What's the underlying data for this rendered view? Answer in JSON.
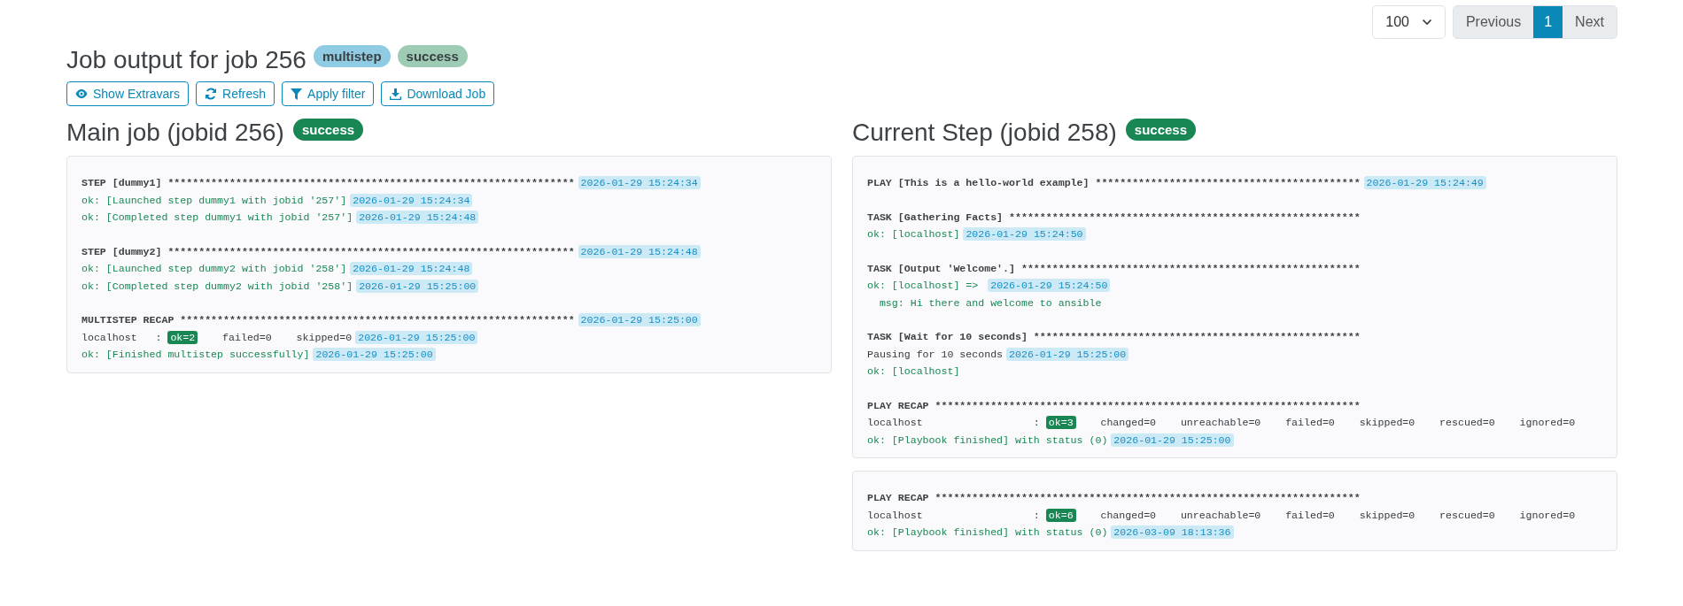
{
  "pagination": {
    "page_size": "100",
    "previous": "Previous",
    "pages": [
      {
        "label": "1",
        "selected": true
      }
    ],
    "next": "Next"
  },
  "header": {
    "title": "Job output for job 256",
    "badges": [
      {
        "label": "multistep",
        "kind": "type"
      },
      {
        "label": "success",
        "kind": "status"
      }
    ]
  },
  "toolbar": [
    {
      "label": "Show Extravars",
      "kind": "eye"
    },
    {
      "label": "Refresh",
      "kind": "refresh"
    },
    {
      "label": "Apply filter",
      "kind": "filter"
    },
    {
      "label": "Download Job",
      "kind": "download"
    }
  ],
  "panels": [
    {
      "title": "Main job (jobid 256)",
      "status": "success",
      "cards": [
        {
          "blocks": [
            [
              [
                {
                  "kind": "head",
                  "text": "STEP [dummy1] ******************************************************************"
                },
                {
                  "kind": "time",
                  "text": "2026-01-29 15:24:34"
                }
              ],
              [
                {
                  "kind": "ok",
                  "text": "ok: [Launched step dummy1 with jobid '257']"
                },
                {
                  "kind": "time",
                  "text": "2026-01-29 15:24:34"
                }
              ],
              [
                {
                  "kind": "ok",
                  "text": "ok: [Completed step dummy1 with jobid '257']"
                },
                {
                  "kind": "time",
                  "text": "2026-01-29 15:24:48"
                }
              ]
            ],
            [
              [
                {
                  "kind": "head",
                  "text": "STEP [dummy2] ******************************************************************"
                },
                {
                  "kind": "time",
                  "text": "2026-01-29 15:24:48"
                }
              ],
              [
                {
                  "kind": "ok",
                  "text": "ok: [Launched step dummy2 with jobid '258']"
                },
                {
                  "kind": "time",
                  "text": "2026-01-29 15:24:48"
                }
              ],
              [
                {
                  "kind": "ok",
                  "text": "ok: [Completed step dummy2 with jobid '258']"
                },
                {
                  "kind": "time",
                  "text": "2026-01-29 15:25:00"
                }
              ]
            ],
            [
              [
                {
                  "kind": "head",
                  "text": "MULTISTEP RECAP ****************************************************************"
                },
                {
                  "kind": "time",
                  "text": "2026-01-29 15:25:00"
                }
              ],
              [
                {
                  "kind": "plain",
                  "text": "localhost   : "
                },
                {
                  "kind": "count",
                  "text": "ok=2"
                },
                {
                  "kind": "plain",
                  "text": "    failed=0    skipped=0"
                },
                {
                  "kind": "time",
                  "text": "2026-01-29 15:25:00"
                }
              ],
              [
                {
                  "kind": "ok",
                  "text": "ok: [Finished multistep successfully]"
                },
                {
                  "kind": "time",
                  "text": "2026-01-29 15:25:00"
                }
              ]
            ]
          ]
        }
      ]
    },
    {
      "title": "Current Step (jobid 258)",
      "status": "success",
      "cards": [
        {
          "blocks": [
            [
              [
                {
                  "kind": "head",
                  "text": "PLAY [This is a hello-world example] *******************************************"
                },
                {
                  "kind": "time",
                  "text": "2026-01-29 15:24:49"
                }
              ]
            ],
            [
              [
                {
                  "kind": "head",
                  "text": "TASK [Gathering Facts] *********************************************************"
                }
              ],
              [
                {
                  "kind": "ok",
                  "text": "ok: [localhost]"
                },
                {
                  "kind": "time",
                  "text": "2026-01-29 15:24:50"
                }
              ]
            ],
            [
              [
                {
                  "kind": "head",
                  "text": "TASK [Output 'Welcome'.] *******************************************************"
                }
              ],
              [
                {
                  "kind": "ok",
                  "text": "ok: [localhost] => "
                },
                {
                  "kind": "time",
                  "text": "2026-01-29 15:24:50"
                }
              ],
              [
                {
                  "kind": "ok",
                  "text": "  msg: Hi there and welcome to ansible"
                }
              ]
            ],
            [
              [
                {
                  "kind": "head",
                  "text": "TASK [Wait for 10 seconds] *****************************************************"
                }
              ],
              [
                {
                  "kind": "plain",
                  "text": "Pausing for 10 seconds"
                },
                {
                  "kind": "time",
                  "text": "2026-01-29 15:25:00"
                }
              ],
              [
                {
                  "kind": "ok",
                  "text": "ok: [localhost]"
                }
              ]
            ],
            [
              [
                {
                  "kind": "head",
                  "text": "PLAY RECAP *********************************************************************"
                }
              ],
              [
                {
                  "kind": "plain",
                  "text": "localhost                  : "
                },
                {
                  "kind": "count",
                  "text": "ok=3"
                },
                {
                  "kind": "plain",
                  "text": "    changed=0    unreachable=0    failed=0    skipped=0    rescued=0    ignored=0"
                }
              ],
              [
                {
                  "kind": "ok",
                  "text": "ok: [Playbook finished] with status (0)"
                },
                {
                  "kind": "time",
                  "text": "2026-01-29 15:25:00"
                }
              ]
            ]
          ]
        },
        {
          "blocks": [
            [
              [
                {
                  "kind": "head",
                  "text": "PLAY RECAP *********************************************************************"
                }
              ],
              [
                {
                  "kind": "plain",
                  "text": "localhost                  : "
                },
                {
                  "kind": "count",
                  "text": "ok=6"
                },
                {
                  "kind": "plain",
                  "text": "    changed=0    unreachable=0    failed=0    skipped=0    rescued=0    ignored=0"
                }
              ],
              [
                {
                  "kind": "ok",
                  "text": "ok: [Playbook finished] with status (0)"
                },
                {
                  "kind": "time",
                  "text": "2026-03-09 18:13:36"
                }
              ]
            ]
          ]
        }
      ]
    }
  ]
}
